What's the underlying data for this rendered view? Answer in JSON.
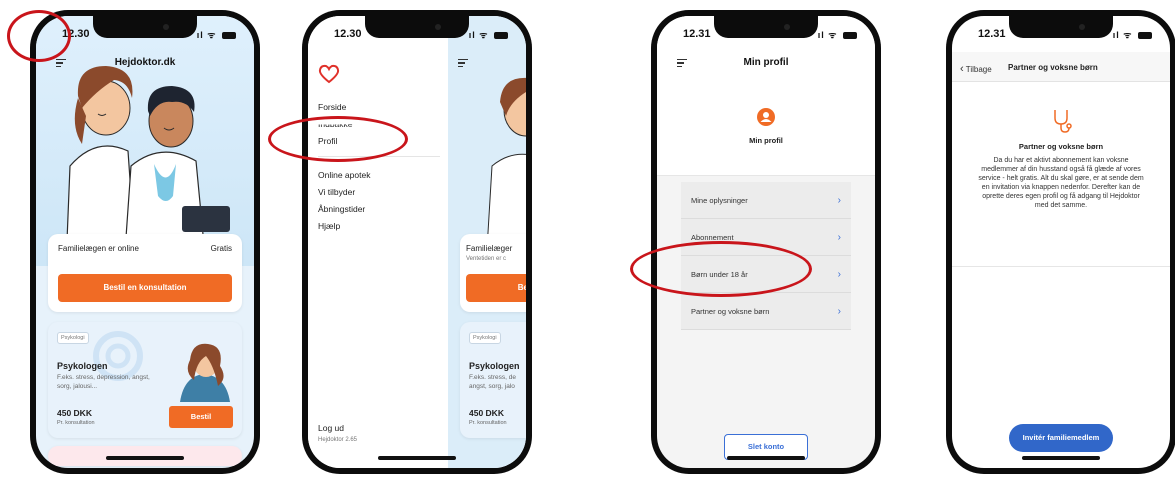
{
  "colors": {
    "orange": "#f06b25",
    "blue": "#3167c9",
    "annotation_red": "#c9151b"
  },
  "phone1": {
    "time": "12.30",
    "title": "Hejdoktor.dk",
    "online_label": "Familielægen er online",
    "online_price": "Gratis",
    "cta": "Bestil en konsultation",
    "psych_tag": "Psykologi",
    "psych_title": "Psykologen",
    "psych_desc": "F.eks. stress, depression, angst, sorg, jalousi...",
    "psych_price": "450 DKK",
    "psych_price_sub": "Pr. konsultation",
    "psych_button": "Bestil"
  },
  "phone2": {
    "time": "12.30",
    "menu": [
      "Forside",
      "Indbakke",
      "Profil",
      "Online apotek",
      "Vi tilbyder",
      "Åbningstider",
      "Hjælp"
    ],
    "logout": "Log ud",
    "version": "Hejdoktor 2.65",
    "behind_title": "Familielæger",
    "behind_sub": "Ventetiden er c",
    "behind_cta": "Be",
    "behind_tag": "Psykologi",
    "behind_psych": "Psykologen",
    "behind_desc": "F.eks. stress, de angst, sorg, jalo",
    "behind_price": "450 DKK",
    "behind_price_sub": "Pr. konsultation"
  },
  "phone3": {
    "time": "12.31",
    "title": "Min profil",
    "profile_label": "Min profil",
    "rows": [
      "Mine oplysninger",
      "Abonnement",
      "Børn under 18 år",
      "Partner og voksne børn"
    ],
    "delete_button": "Slet konto"
  },
  "phone4": {
    "time": "12.31",
    "back": "Tilbage",
    "title": "Partner og voksne børn",
    "section_title": "Partner og voksne børn",
    "body": "Da du har et aktivt abonnement kan voksne medlemmer af din husstand også få glæde af vores service - helt gratis. Alt du skal gøre, er at sende dem en invitation via knappen nedenfor. Derefter kan de oprette deres egen profil og få adgang til Hejdoktor med det samme.",
    "invite_button": "Invitér familiemedlem"
  }
}
